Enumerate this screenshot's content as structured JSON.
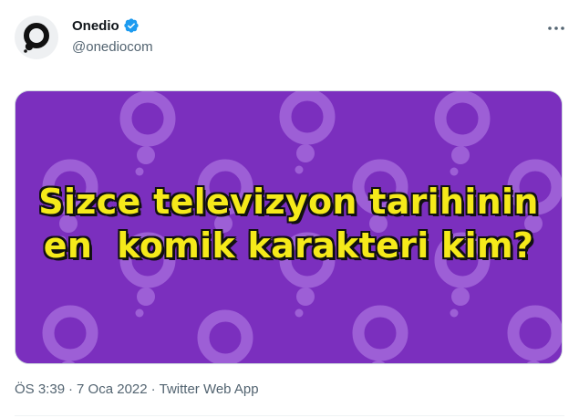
{
  "account": {
    "display_name": "Onedio",
    "handle": "@onediocom",
    "verified": true,
    "avatar_icon": "onedio-logo-icon"
  },
  "menu": {
    "more_icon": "more-horizontal-icon"
  },
  "media": {
    "headline_line1": "Sizce televizyon tarihinin",
    "headline_line2": "en  komik karakteri kim?",
    "background_color": "#7b2fbe",
    "pattern_color": "#9d5fd6",
    "text_color": "#f5ea1a"
  },
  "meta": {
    "time": "ÖS 3:39",
    "separator": "·",
    "date": "7 Oca 2022",
    "source": "Twitter Web App"
  },
  "colors": {
    "verified_badge": "#1d9bf0",
    "secondary_text": "#536471"
  }
}
